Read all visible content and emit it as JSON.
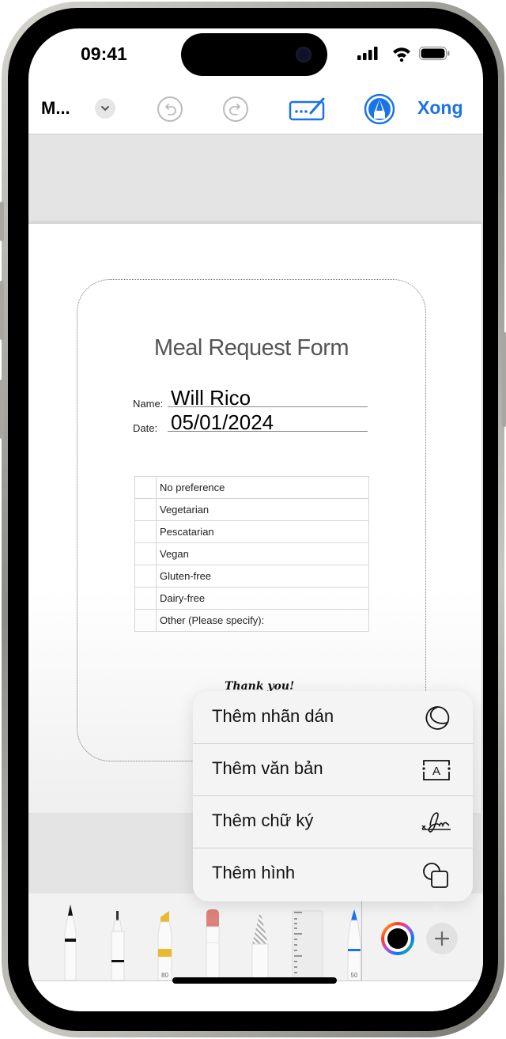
{
  "status_bar": {
    "time": "09:41",
    "signal_icon": "cellular-signal-icon",
    "wifi_icon": "wifi-icon",
    "battery_icon": "battery-icon"
  },
  "toolbar": {
    "title": "M...",
    "title_menu_icon": "chevron-down-icon",
    "undo_icon": "undo-icon",
    "redo_icon": "redo-icon",
    "keyboard_pencil_icon": "keyboard-pencil-icon",
    "markup_icon": "markup-pen-icon",
    "done_label": "Xong",
    "accent_color": "#1a73e8"
  },
  "document": {
    "form_title": "Meal Request Form",
    "name_label": "Name:",
    "name_value": "Will Rico",
    "date_label": "Date:",
    "date_value": "05/01/2024",
    "options": [
      "No preference",
      "Vegetarian",
      "Pescatarian",
      "Vegan",
      "Gluten-free",
      "Dairy-free",
      "Other (Please specify):"
    ],
    "thanks": "Thank you!"
  },
  "popup_menu": {
    "items": [
      {
        "label": "Thêm nhãn dán",
        "icon": "sticker-icon"
      },
      {
        "label": "Thêm văn bản",
        "icon": "text-box-icon"
      },
      {
        "label": "Thêm chữ ký",
        "icon": "signature-icon"
      },
      {
        "label": "Thêm hình",
        "icon": "shapes-icon"
      }
    ]
  },
  "tools": {
    "items": [
      {
        "name": "pen",
        "icon": "pen-icon"
      },
      {
        "name": "fineliner",
        "icon": "fineliner-icon"
      },
      {
        "name": "highlighter",
        "icon": "highlighter-icon",
        "label": "80",
        "color": "#e9b930"
      },
      {
        "name": "eraser",
        "icon": "eraser-icon",
        "color": "#de807c"
      },
      {
        "name": "lasso",
        "icon": "lasso-icon"
      },
      {
        "name": "ruler",
        "icon": "ruler-icon"
      },
      {
        "name": "pencil",
        "icon": "pencil-icon",
        "label": "50",
        "color": "#1a73e8"
      }
    ],
    "color_picker": {
      "icon": "color-picker-icon",
      "selected_color": "#000000"
    },
    "add_button": {
      "icon": "plus-icon"
    }
  }
}
